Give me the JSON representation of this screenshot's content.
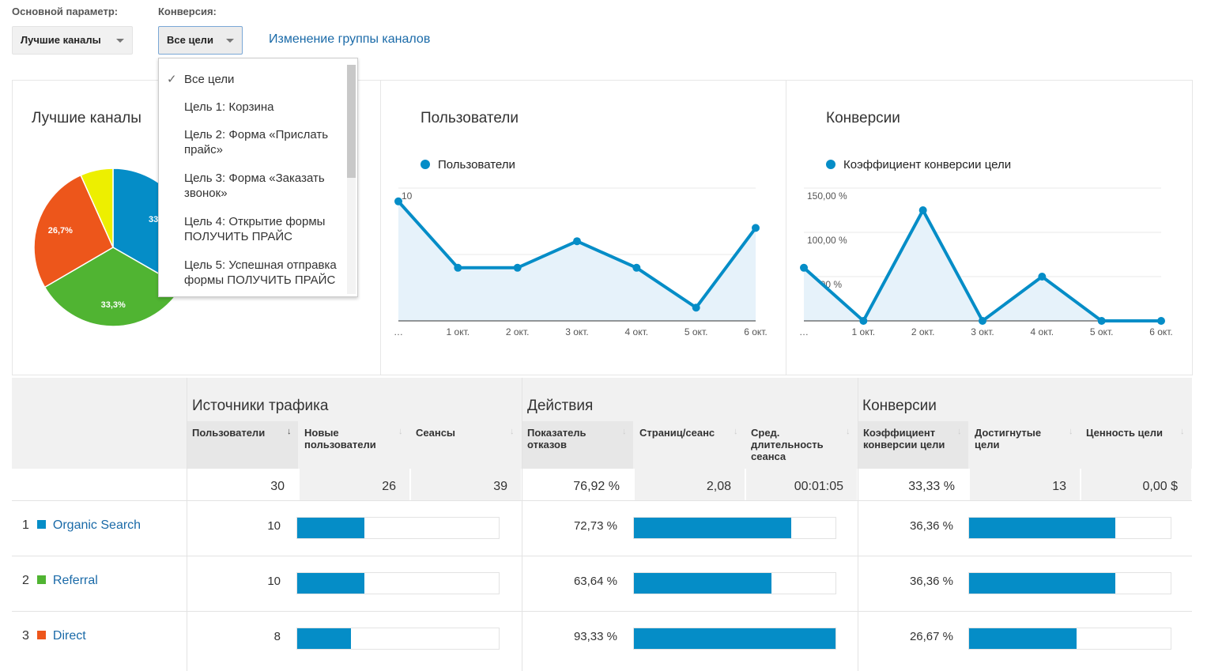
{
  "controls": {
    "primary_label": "Основной параметр:",
    "primary_value": "Лучшие каналы",
    "conversion_label": "Конверсия:",
    "conversion_value": "Все цели",
    "change_link": "Изменение группы каналов"
  },
  "dropdown": {
    "items": [
      {
        "label": "Все цели",
        "checked": true
      },
      {
        "label": "Цель 1: Корзина"
      },
      {
        "label": "Цель 2: Форма «Прислать прайс»"
      },
      {
        "label": "Цель 3: Форма «Заказать звонок»"
      },
      {
        "label": "Цель 4: Открытие формы ПОЛУЧИТЬ ПРАЙС"
      },
      {
        "label": "Цель 5: Успешная отправка формы ПОЛУЧИТЬ ПРАЙС"
      }
    ]
  },
  "chart_data": [
    {
      "type": "pie",
      "title": "Лучшие каналы",
      "values": [
        33.3,
        33.3,
        26.7,
        6.7
      ],
      "labels": [
        "33,3%",
        "33,3%",
        "26,7%",
        ""
      ],
      "colors": [
        "#058dc7",
        "#50b432",
        "#ed561b",
        "#edef00"
      ]
    },
    {
      "type": "area",
      "title": "Пользователи",
      "legend": [
        "Пользователи"
      ],
      "categories": [
        "…",
        "1 окт.",
        "2 окт.",
        "3 окт.",
        "4 окт.",
        "5 окт.",
        "6 окт."
      ],
      "values": [
        9,
        4,
        4,
        6,
        4,
        1,
        7
      ],
      "yticks": [
        "10",
        "5"
      ],
      "ylim": [
        0,
        10
      ],
      "grid": true
    },
    {
      "type": "area",
      "title": "Конверсии",
      "legend": [
        "Коэффициент конверсии цели"
      ],
      "categories": [
        "…",
        "1 окт.",
        "2 окт.",
        "3 окт.",
        "4 окт.",
        "5 окт.",
        "6 окт."
      ],
      "values": [
        60,
        0,
        125,
        0,
        50,
        0,
        0
      ],
      "yticks": [
        "150,00 %",
        "100,00 %",
        "50,00 %"
      ],
      "ylim": [
        0,
        150
      ],
      "grid": true
    }
  ],
  "table": {
    "groups": [
      "Источники трафика",
      "Действия",
      "Конверсии"
    ],
    "columns": [
      "Пользователи",
      "Новые пользователи",
      "Сеансы",
      "Показатель отказов",
      "Страниц/сеанс",
      "Сред. длительность сеанса",
      "Коэффициент конверсии цели",
      "Достигнутые цели",
      "Ценность цели"
    ],
    "totals": [
      "30",
      "26",
      "39",
      "76,92 %",
      "2,08",
      "00:01:05",
      "33,33 %",
      "13",
      "0,00 $"
    ],
    "rows": [
      {
        "n": "1",
        "name": "Organic Search",
        "color": "#058dc7",
        "users": "10",
        "users_bar": 33.3,
        "bounce": "72,73 %",
        "bounce_bar": 77.9,
        "conv": "36,36 %",
        "conv_bar": 72.7
      },
      {
        "n": "2",
        "name": "Referral",
        "color": "#50b432",
        "users": "10",
        "users_bar": 33.3,
        "bounce": "63,64 %",
        "bounce_bar": 68.2,
        "conv": "36,36 %",
        "conv_bar": 72.7
      },
      {
        "n": "3",
        "name": "Direct",
        "color": "#ed561b",
        "users": "8",
        "users_bar": 26.7,
        "bounce": "93,33 %",
        "bounce_bar": 100,
        "conv": "26,67 %",
        "conv_bar": 53.3
      }
    ]
  }
}
